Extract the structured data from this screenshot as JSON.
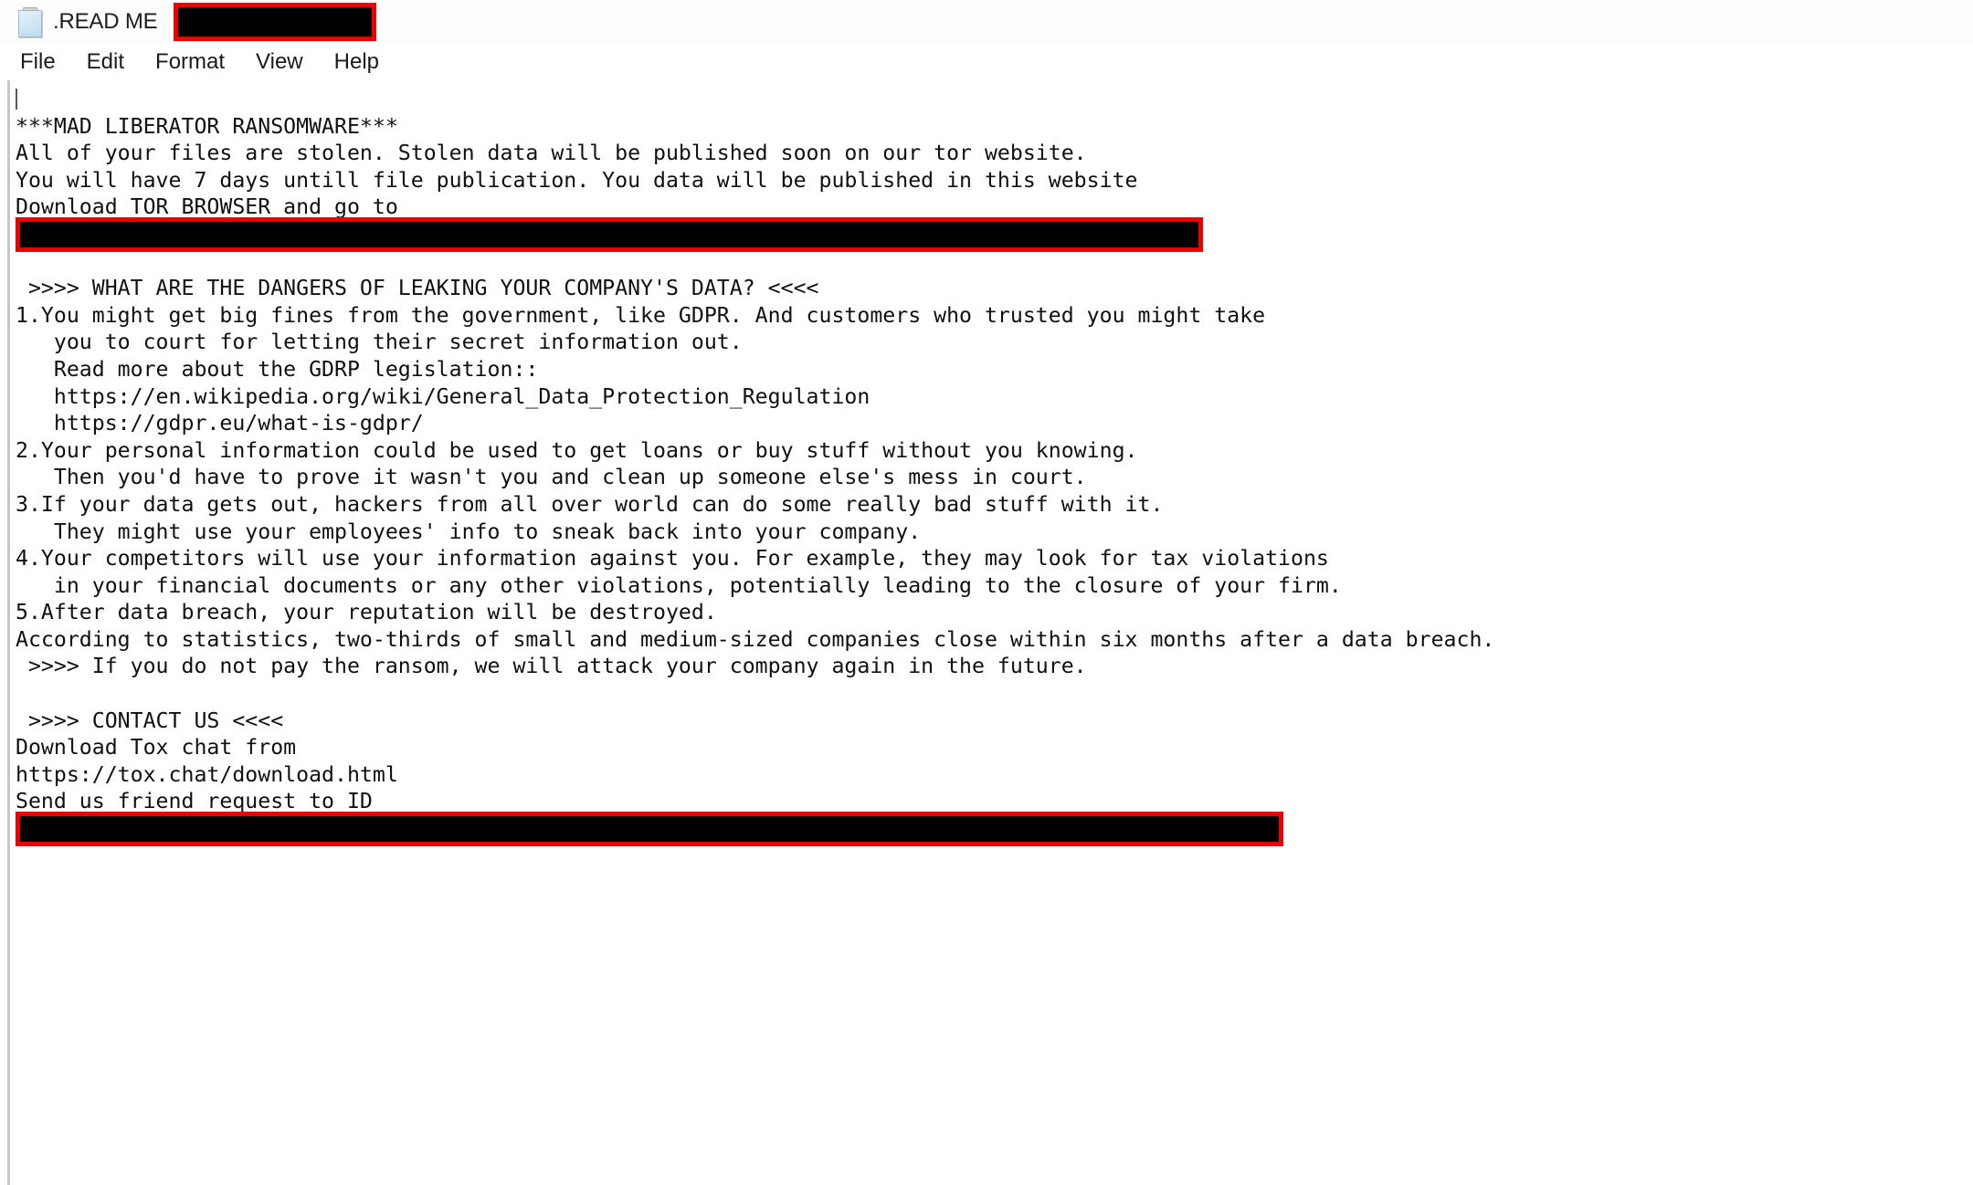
{
  "window": {
    "title": ".READ ME",
    "icon": "notepad-icon",
    "redaction_color_fill": "#000000",
    "redaction_color_border": "#ee0000"
  },
  "menu": {
    "items": [
      {
        "label": "File"
      },
      {
        "label": "Edit"
      },
      {
        "label": "Format"
      },
      {
        "label": "View"
      },
      {
        "label": "Help"
      }
    ]
  },
  "document": {
    "lines": [
      {
        "type": "caret",
        "text": ""
      },
      {
        "type": "text",
        "text": "***MAD LIBERATOR RANSOMWARE***"
      },
      {
        "type": "text",
        "text": "All of your files are stolen. Stolen data will be published soon on our tor website."
      },
      {
        "type": "text",
        "text": "You will have 7 days untill file publication. You data will be published in this website"
      },
      {
        "type": "text",
        "text": "Download TOR BROWSER and go to"
      },
      {
        "type": "redaction",
        "variant": "redaction-body-1",
        "text": ""
      },
      {
        "type": "text",
        "text": ""
      },
      {
        "type": "text",
        "text": " >>>> WHAT ARE THE DANGERS OF LEAKING YOUR COMPANY'S DATA? <<<<"
      },
      {
        "type": "text",
        "text": "1.You might get big fines from the government, like GDPR. And customers who trusted you might take"
      },
      {
        "type": "text",
        "text": "   you to court for letting their secret information out."
      },
      {
        "type": "text",
        "text": "   Read more about the GDRP legislation::"
      },
      {
        "type": "text",
        "text": "   https://en.wikipedia.org/wiki/General_Data_Protection_Regulation"
      },
      {
        "type": "text",
        "text": "   https://gdpr.eu/what-is-gdpr/"
      },
      {
        "type": "text",
        "text": "2.Your personal information could be used to get loans or buy stuff without you knowing."
      },
      {
        "type": "text",
        "text": "   Then you'd have to prove it wasn't you and clean up someone else's mess in court."
      },
      {
        "type": "text",
        "text": "3.If your data gets out, hackers from all over world can do some really bad stuff with it."
      },
      {
        "type": "text",
        "text": "   They might use your employees' info to sneak back into your company."
      },
      {
        "type": "text",
        "text": "4.Your competitors will use your information against you. For example, they may look for tax violations"
      },
      {
        "type": "text",
        "text": "   in your financial documents or any other violations, potentially leading to the closure of your firm."
      },
      {
        "type": "text",
        "text": "5.After data breach, your reputation will be destroyed."
      },
      {
        "type": "text",
        "text": "According to statistics, two-thirds of small and medium-sized companies close within six months after a data breach."
      },
      {
        "type": "text",
        "text": " >>>> If you do not pay the ransom, we will attack your company again in the future."
      },
      {
        "type": "text",
        "text": ""
      },
      {
        "type": "text",
        "text": " >>>> CONTACT US <<<<"
      },
      {
        "type": "text",
        "text": "Download Tox chat from"
      },
      {
        "type": "text",
        "text": "https://tox.chat/download.html"
      },
      {
        "type": "text",
        "text": "Send us friend request to ID"
      },
      {
        "type": "redaction",
        "variant": "redaction-body-2",
        "text": ""
      },
      {
        "type": "text",
        "text": ""
      }
    ]
  }
}
